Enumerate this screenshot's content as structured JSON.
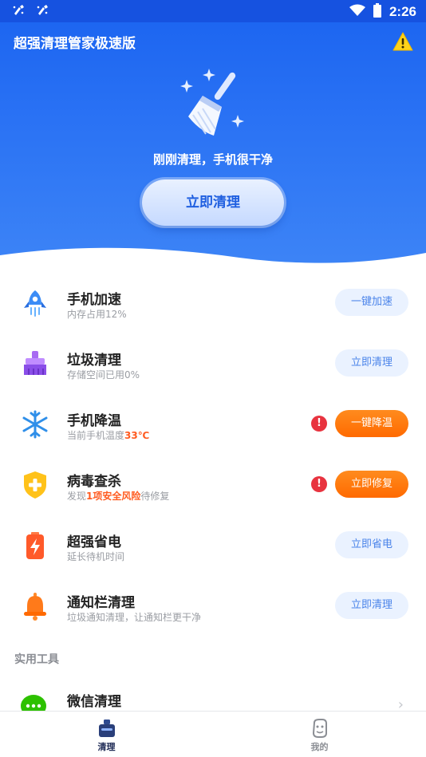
{
  "status_bar": {
    "time": "2:26"
  },
  "header": {
    "title": "超强清理管家极速版",
    "hero_status": "刚刚清理，手机很干净",
    "clean_button": "立即清理"
  },
  "rows": [
    {
      "title": "手机加速",
      "sub": "内存占用12%",
      "button": "一键加速"
    },
    {
      "title": "垃圾清理",
      "sub": "存储空间已用0%",
      "button": "立即清理"
    },
    {
      "title": "手机降温",
      "sub_pre": "当前手机温度",
      "sub_hl": "33℃",
      "sub_post": "",
      "button": "一键降温",
      "alert": "!"
    },
    {
      "title": "病毒查杀",
      "sub_pre": "发现",
      "sub_hl": "1项安全风险",
      "sub_post": "待修复",
      "button": "立即修复",
      "alert": "!"
    },
    {
      "title": "超强省电",
      "sub": "延长待机时间",
      "button": "立即省电"
    },
    {
      "title": "通知栏清理",
      "sub": "垃圾通知清理，让通知栏更干净",
      "button": "立即清理"
    }
  ],
  "tools": {
    "section_label": "实用工具",
    "items": [
      {
        "title": "微信清理"
      }
    ]
  },
  "bottom_nav": {
    "tabs": [
      {
        "label": "清理",
        "active": true
      },
      {
        "label": "我的",
        "active": false
      }
    ]
  },
  "colors": {
    "primary": "#2a72f4",
    "orange": "#ff6a00",
    "alert": "#e8333f"
  }
}
